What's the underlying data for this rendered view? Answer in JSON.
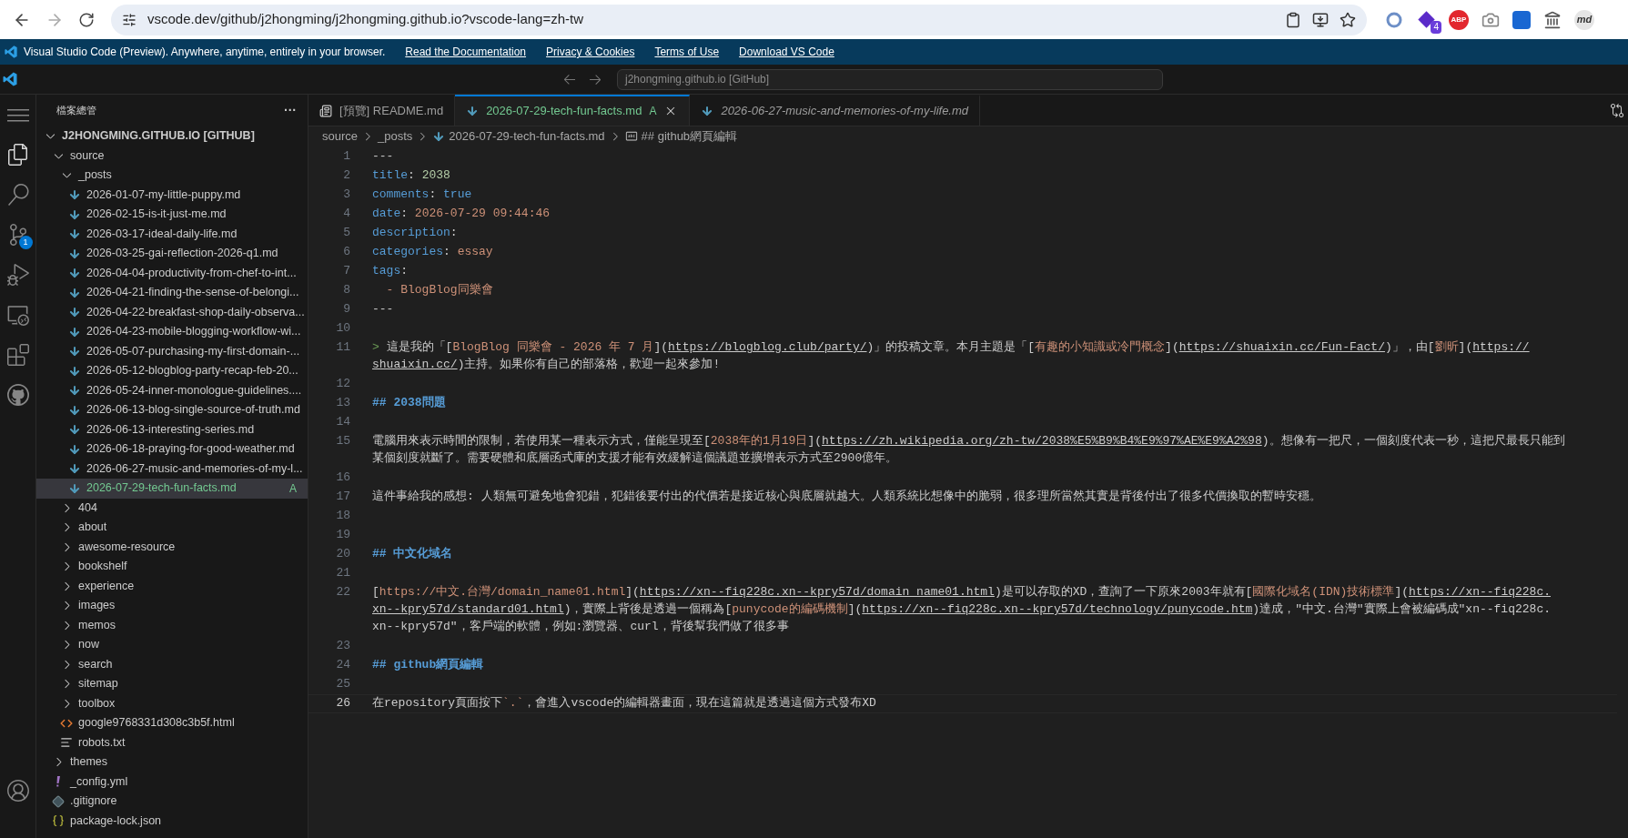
{
  "browser": {
    "url": "vscode.dev/github/j2hongming/j2hongming.github.io?vscode-lang=zh-tw",
    "extension_badge": "4",
    "adblock_label": "ABP",
    "markdown_ext_label": "md"
  },
  "banner": {
    "text": "Visual Studio Code (Preview). Anywhere, anytime, entirely in your browser.",
    "links": [
      "Read the Documentation",
      "Privacy & Cookies",
      "Terms of Use",
      "Download VS Code"
    ]
  },
  "title_bar": {
    "command_center": "j2hongming.github.io [GitHub]"
  },
  "activity_bar": {
    "source_control_badge": "1"
  },
  "sidebar": {
    "title": "檔案總管",
    "more": "···",
    "tree": [
      {
        "label": "J2HONGMING.GITHUB.IO [GITHUB]",
        "kind": "root",
        "expanded": true,
        "selected": false,
        "children": [
          {
            "label": "source",
            "kind": "folder",
            "expanded": true,
            "selected": false,
            "children": [
              {
                "label": "_posts",
                "kind": "folder",
                "expanded": true,
                "selected": false,
                "children": [
                  {
                    "label": "2026-01-07-my-little-puppy.md",
                    "kind": "markdown",
                    "selected": false
                  },
                  {
                    "label": "2026-02-15-is-it-just-me.md",
                    "kind": "markdown",
                    "selected": false
                  },
                  {
                    "label": "2026-03-17-ideal-daily-life.md",
                    "kind": "markdown",
                    "selected": false
                  },
                  {
                    "label": "2026-03-25-gai-reflection-2026-q1.md",
                    "kind": "markdown",
                    "selected": false
                  },
                  {
                    "label": "2026-04-04-productivity-from-chef-to-int...",
                    "kind": "markdown",
                    "selected": false
                  },
                  {
                    "label": "2026-04-21-finding-the-sense-of-belongi...",
                    "kind": "markdown",
                    "selected": false
                  },
                  {
                    "label": "2026-04-22-breakfast-shop-daily-observa...",
                    "kind": "markdown",
                    "selected": false
                  },
                  {
                    "label": "2026-04-23-mobile-blogging-workflow-wi...",
                    "kind": "markdown",
                    "selected": false
                  },
                  {
                    "label": "2026-05-07-purchasing-my-first-domain-...",
                    "kind": "markdown",
                    "selected": false
                  },
                  {
                    "label": "2026-05-12-blogblog-party-recap-feb-20...",
                    "kind": "markdown",
                    "selected": false
                  },
                  {
                    "label": "2026-05-24-inner-monologue-guidelines....",
                    "kind": "markdown",
                    "selected": false
                  },
                  {
                    "label": "2026-06-13-blog-single-source-of-truth.md",
                    "kind": "markdown",
                    "selected": false
                  },
                  {
                    "label": "2026-06-13-interesting-series.md",
                    "kind": "markdown",
                    "selected": false
                  },
                  {
                    "label": "2026-06-18-praying-for-good-weather.md",
                    "kind": "markdown",
                    "selected": false
                  },
                  {
                    "label": "2026-06-27-music-and-memories-of-my-l...",
                    "kind": "markdown",
                    "selected": false
                  },
                  {
                    "label": "2026-07-29-tech-fun-facts.md",
                    "kind": "markdown",
                    "selected": true,
                    "badge": "A"
                  }
                ]
              },
              {
                "label": "404",
                "kind": "folder",
                "expanded": false,
                "selected": false
              },
              {
                "label": "about",
                "kind": "folder",
                "expanded": false,
                "selected": false
              },
              {
                "label": "awesome-resource",
                "kind": "folder",
                "expanded": false,
                "selected": false
              },
              {
                "label": "bookshelf",
                "kind": "folder",
                "expanded": false,
                "selected": false
              },
              {
                "label": "experience",
                "kind": "folder",
                "expanded": false,
                "selected": false
              },
              {
                "label": "images",
                "kind": "folder",
                "expanded": false,
                "selected": false
              },
              {
                "label": "memos",
                "kind": "folder",
                "expanded": false,
                "selected": false
              },
              {
                "label": "now",
                "kind": "folder",
                "expanded": false,
                "selected": false
              },
              {
                "label": "search",
                "kind": "folder",
                "expanded": false,
                "selected": false
              },
              {
                "label": "sitemap",
                "kind": "folder",
                "expanded": false,
                "selected": false
              },
              {
                "label": "toolbox",
                "kind": "folder",
                "expanded": false,
                "selected": false
              },
              {
                "label": "google9768331d308c3b5f.html",
                "kind": "html",
                "selected": false
              },
              {
                "label": "robots.txt",
                "kind": "text",
                "selected": false
              }
            ]
          },
          {
            "label": "themes",
            "kind": "folder",
            "expanded": false,
            "selected": false
          },
          {
            "label": "_config.yml",
            "kind": "yaml",
            "selected": false
          },
          {
            "label": ".gitignore",
            "kind": "git",
            "selected": false
          },
          {
            "label": "package-lock.json",
            "kind": "json",
            "selected": false
          }
        ]
      }
    ]
  },
  "tabs": [
    {
      "label": "[預覽] README.md",
      "kind": "preview",
      "selected": false,
      "italic": false
    },
    {
      "label": "2026-07-29-tech-fun-facts.md",
      "kind": "markdown",
      "selected": true,
      "italic": false,
      "badge": "A"
    },
    {
      "label": "2026-06-27-music-and-memories-of-my-life.md",
      "kind": "markdown",
      "selected": false,
      "italic": true
    }
  ],
  "breadcrumbs": [
    {
      "label": "source",
      "kind": "folder"
    },
    {
      "label": "_posts",
      "kind": "folder"
    },
    {
      "label": "2026-07-29-tech-fun-facts.md",
      "kind": "markdown"
    },
    {
      "label": "## github網頁編輯",
      "kind": "symbol"
    }
  ],
  "editor": {
    "lines": [
      {
        "number": "1",
        "current": false,
        "rows": [
          {
            "segments": [
              {
                "kind": "text",
                "text": "---"
              }
            ]
          }
        ]
      },
      {
        "number": "2",
        "current": false,
        "rows": [
          {
            "segments": [
              {
                "kind": "key",
                "text": "title"
              },
              {
                "kind": "text",
                "text": ": "
              },
              {
                "kind": "number",
                "text": "2038"
              }
            ]
          }
        ]
      },
      {
        "number": "3",
        "current": false,
        "rows": [
          {
            "segments": [
              {
                "kind": "key",
                "text": "comments"
              },
              {
                "kind": "text",
                "text": ": "
              },
              {
                "kind": "bool",
                "text": "true"
              }
            ]
          }
        ]
      },
      {
        "number": "4",
        "current": false,
        "rows": [
          {
            "segments": [
              {
                "kind": "key",
                "text": "date"
              },
              {
                "kind": "text",
                "text": ": "
              },
              {
                "kind": "string",
                "text": "2026-07-29 09:44:46"
              }
            ]
          }
        ]
      },
      {
        "number": "5",
        "current": false,
        "rows": [
          {
            "segments": [
              {
                "kind": "key",
                "text": "description"
              },
              {
                "kind": "text",
                "text": ":"
              }
            ]
          }
        ]
      },
      {
        "number": "6",
        "current": false,
        "rows": [
          {
            "segments": [
              {
                "kind": "key",
                "text": "categories"
              },
              {
                "kind": "text",
                "text": ": "
              },
              {
                "kind": "string",
                "text": "essay"
              }
            ]
          }
        ]
      },
      {
        "number": "7",
        "current": false,
        "rows": [
          {
            "segments": [
              {
                "kind": "key",
                "text": "tags"
              },
              {
                "kind": "text",
                "text": ":"
              }
            ]
          }
        ]
      },
      {
        "number": "8",
        "current": false,
        "rows": [
          {
            "segments": [
              {
                "kind": "string",
                "text": "  - BlogBlog同樂會"
              }
            ]
          }
        ]
      },
      {
        "number": "9",
        "current": false,
        "rows": [
          {
            "segments": [
              {
                "kind": "text",
                "text": "---"
              }
            ]
          }
        ]
      },
      {
        "number": "10",
        "current": false
      },
      {
        "number": "11",
        "current": false,
        "rows": [
          {
            "segments": [
              {
                "kind": "quote",
                "text": ">"
              },
              {
                "kind": "text",
                "text": " 這是我的「["
              },
              {
                "kind": "link_text",
                "text": "BlogBlog 同樂會 - 2026 年 7 月"
              },
              {
                "kind": "text",
                "text": "]("
              },
              {
                "kind": "url",
                "text": "https://blogblog.club/party/"
              },
              {
                "kind": "text",
                "text": ")」的投稿文章。本月主題是「["
              },
              {
                "kind": "link_text",
                "text": "有趣的小知識或冷門概念"
              },
              {
                "kind": "text",
                "text": "]("
              },
              {
                "kind": "url",
                "text": "https://shuaixin.cc/Fun-Fact/"
              },
              {
                "kind": "text",
                "text": ")」，由["
              },
              {
                "kind": "link_text",
                "text": "劉昕"
              },
              {
                "kind": "text",
                "text": "]("
              },
              {
                "kind": "url",
                "text": "https://"
              }
            ]
          },
          {
            "segments": [
              {
                "kind": "url",
                "text": "shuaixin.cc/"
              },
              {
                "kind": "text",
                "text": ")主持。如果你有自己的部落格，歡迎一起來參加!"
              }
            ]
          }
        ]
      },
      {
        "number": "12",
        "current": false
      },
      {
        "number": "13",
        "current": false,
        "rows": [
          {
            "segments": [
              {
                "kind": "heading",
                "text": "## 2038問題"
              }
            ]
          }
        ]
      },
      {
        "number": "14",
        "current": false
      },
      {
        "number": "15",
        "current": false,
        "rows": [
          {
            "segments": [
              {
                "kind": "text",
                "text": "電腦用來表示時間的限制，若使用某一種表示方式，僅能呈現至["
              },
              {
                "kind": "link_text",
                "text": "2038年的1月19日"
              },
              {
                "kind": "text",
                "text": "]("
              },
              {
                "kind": "url",
                "text": "https://zh.wikipedia.org/zh-tw/2038%E5%B9%B4%E9%97%AE%E9%A2%98"
              },
              {
                "kind": "text",
                "text": ")。想像有一把尺，一個刻度代表一秒，這把尺最長只能到"
              }
            ]
          },
          {
            "segments": [
              {
                "kind": "text",
                "text": "某個刻度就斷了。需要硬體和底層函式庫的支援才能有效緩解這個議題並擴增表示方式至2900億年。"
              }
            ]
          }
        ]
      },
      {
        "number": "16",
        "current": false
      },
      {
        "number": "17",
        "current": false,
        "rows": [
          {
            "segments": [
              {
                "kind": "text",
                "text": "這件事給我的感想: 人類無可避免地會犯錯，犯錯後要付出的代價若是接近核心與底層就越大。人類系統比想像中的脆弱，很多理所當然其實是背後付出了很多代價換取的暫時安穩。"
              }
            ]
          }
        ]
      },
      {
        "number": "18",
        "current": false
      },
      {
        "number": "19",
        "current": false
      },
      {
        "number": "20",
        "current": false,
        "rows": [
          {
            "segments": [
              {
                "kind": "heading",
                "text": "## 中文化域名"
              }
            ]
          }
        ]
      },
      {
        "number": "21",
        "current": false
      },
      {
        "number": "22",
        "current": false,
        "rows": [
          {
            "segments": [
              {
                "kind": "text",
                "text": "["
              },
              {
                "kind": "link_text",
                "text": "https://中文.台灣/domain_name01.html"
              },
              {
                "kind": "text",
                "text": "]("
              },
              {
                "kind": "url",
                "text": "https://xn--fiq228c.xn--kpry57d/domain_name01.html"
              },
              {
                "kind": "text",
                "text": ")是可以存取的XD，查詢了一下原來2003年就有["
              },
              {
                "kind": "link_text",
                "text": "國際化域名(IDN)技術標準"
              },
              {
                "kind": "text",
                "text": "]("
              },
              {
                "kind": "url",
                "text": "https://xn--fiq228c."
              }
            ]
          },
          {
            "segments": [
              {
                "kind": "url",
                "text": "xn--kpry57d/standard01.html"
              },
              {
                "kind": "text",
                "text": ")，實際上背後是透過一個稱為["
              },
              {
                "kind": "link_text",
                "text": "punycode的編碼機制"
              },
              {
                "kind": "text",
                "text": "]("
              },
              {
                "kind": "url",
                "text": "https://xn--fiq228c.xn--kpry57d/technology/punycode.htm"
              },
              {
                "kind": "text",
                "text": ")達成，\"中文.台灣\"實際上會被編碼成\"xn--fiq228c."
              }
            ]
          },
          {
            "segments": [
              {
                "kind": "text",
                "text": "xn--kpry57d\"，客戶端的軟體，例如:瀏覽器、curl，背後幫我們做了很多事"
              }
            ]
          }
        ]
      },
      {
        "number": "23",
        "current": false
      },
      {
        "number": "24",
        "current": false,
        "rows": [
          {
            "segments": [
              {
                "kind": "heading",
                "text": "## github網頁編輯"
              }
            ]
          }
        ]
      },
      {
        "number": "25",
        "current": false
      },
      {
        "number": "26",
        "current": true,
        "rows": [
          {
            "segments": [
              {
                "kind": "text",
                "text": "在repository頁面按下"
              },
              {
                "kind": "code",
                "text": "`.`"
              },
              {
                "kind": "text",
                "text": "，會進入vscode的編輯器畫面，現在這篇就是透過這個方式發布XD"
              }
            ]
          }
        ]
      }
    ]
  }
}
